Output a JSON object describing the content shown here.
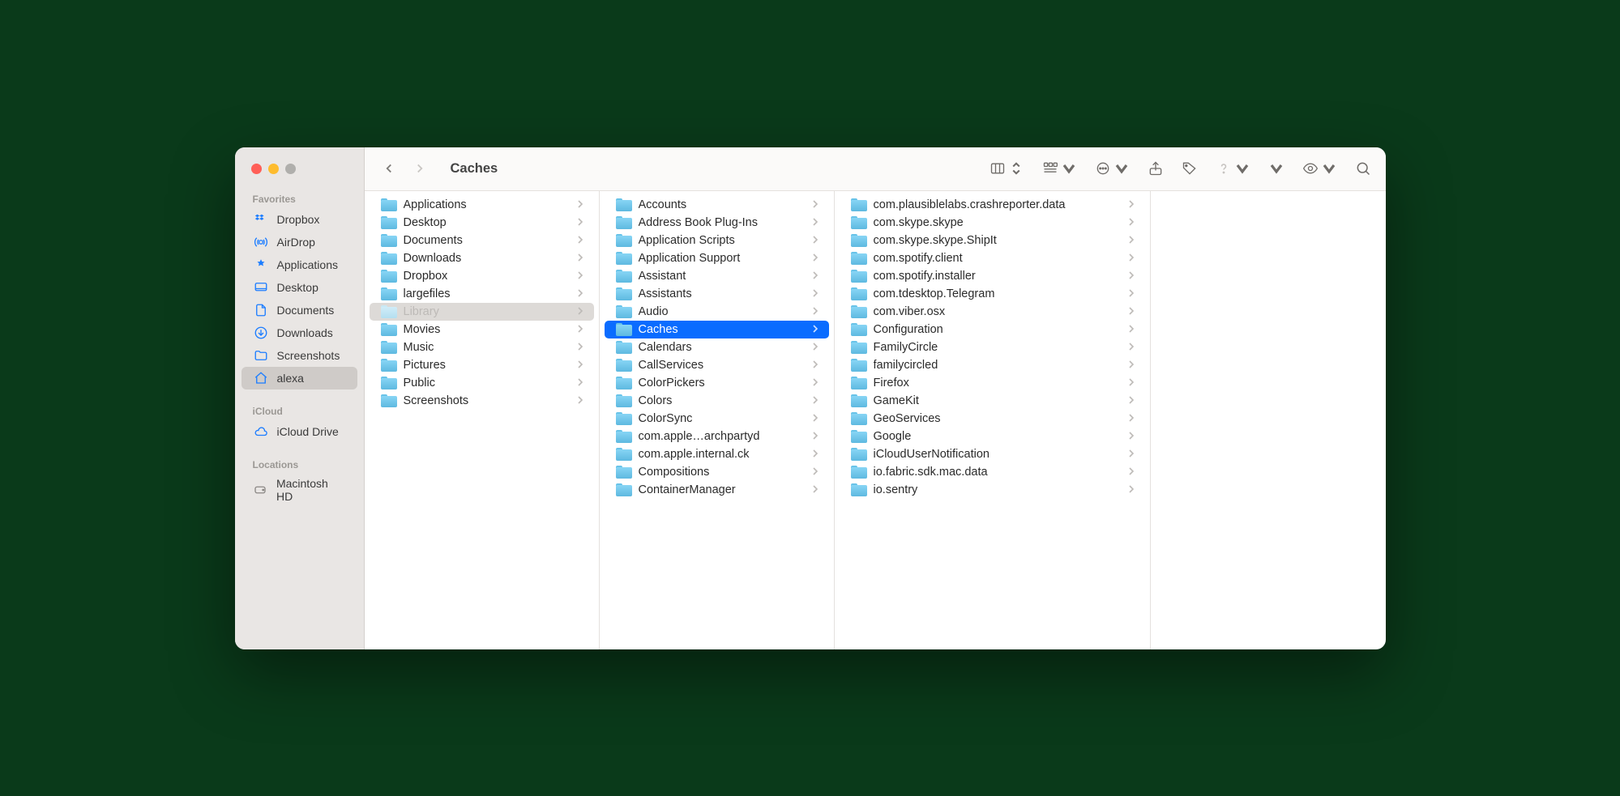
{
  "window_title": "Caches",
  "sidebar": {
    "sections": [
      {
        "label": "Favorites",
        "items": [
          {
            "icon": "dropbox",
            "label": "Dropbox"
          },
          {
            "icon": "airdrop",
            "label": "AirDrop"
          },
          {
            "icon": "apps",
            "label": "Applications"
          },
          {
            "icon": "desktop",
            "label": "Desktop"
          },
          {
            "icon": "documents",
            "label": "Documents"
          },
          {
            "icon": "downloads",
            "label": "Downloads"
          },
          {
            "icon": "folder",
            "label": "Screenshots"
          },
          {
            "icon": "home",
            "label": "alexa",
            "selected": true
          }
        ]
      },
      {
        "label": "iCloud",
        "items": [
          {
            "icon": "cloud",
            "label": "iCloud Drive"
          }
        ]
      },
      {
        "label": "Locations",
        "items": [
          {
            "icon": "disk",
            "label": "Macintosh HD",
            "gray": true
          }
        ]
      }
    ]
  },
  "columns": [
    {
      "items": [
        {
          "name": "Applications",
          "chev": true
        },
        {
          "name": "Desktop",
          "chev": true
        },
        {
          "name": "Documents",
          "chev": true
        },
        {
          "name": "Downloads",
          "chev": true
        },
        {
          "name": "Dropbox",
          "chev": true
        },
        {
          "name": "largefiles",
          "chev": true
        },
        {
          "name": "Library",
          "chev": true,
          "dimmed": true,
          "path_selected": true
        },
        {
          "name": "Movies",
          "chev": true
        },
        {
          "name": "Music",
          "chev": true
        },
        {
          "name": "Pictures",
          "chev": true
        },
        {
          "name": "Public",
          "chev": true
        },
        {
          "name": "Screenshots",
          "chev": true
        }
      ]
    },
    {
      "items": [
        {
          "name": "Accounts",
          "chev": true
        },
        {
          "name": "Address Book Plug-Ins",
          "chev": true
        },
        {
          "name": "Application Scripts",
          "chev": true
        },
        {
          "name": "Application Support",
          "chev": true
        },
        {
          "name": "Assistant",
          "chev": true
        },
        {
          "name": "Assistants",
          "chev": true
        },
        {
          "name": "Audio",
          "chev": true
        },
        {
          "name": "Caches",
          "chev": true,
          "selected": true
        },
        {
          "name": "Calendars",
          "chev": true
        },
        {
          "name": "CallServices",
          "chev": true
        },
        {
          "name": "ColorPickers",
          "chev": true
        },
        {
          "name": "Colors",
          "chev": true
        },
        {
          "name": "ColorSync",
          "chev": true
        },
        {
          "name": "com.apple…archpartyd",
          "chev": true
        },
        {
          "name": "com.apple.internal.ck",
          "chev": true
        },
        {
          "name": "Compositions",
          "chev": true
        },
        {
          "name": "ContainerManager",
          "chev": true
        }
      ]
    },
    {
      "wide": true,
      "items": [
        {
          "name": "com.plausiblelabs.crashreporter.data",
          "chev": true
        },
        {
          "name": "com.skype.skype",
          "chev": true
        },
        {
          "name": "com.skype.skype.ShipIt",
          "chev": true
        },
        {
          "name": "com.spotify.client",
          "chev": true
        },
        {
          "name": "com.spotify.installer",
          "chev": true
        },
        {
          "name": "com.tdesktop.Telegram",
          "chev": true
        },
        {
          "name": "com.viber.osx",
          "chev": true
        },
        {
          "name": "Configuration",
          "chev": true
        },
        {
          "name": "FamilyCircle",
          "chev": true
        },
        {
          "name": "familycircled",
          "chev": true
        },
        {
          "name": "Firefox",
          "chev": true
        },
        {
          "name": "GameKit",
          "chev": true
        },
        {
          "name": "GeoServices",
          "chev": true
        },
        {
          "name": "Google",
          "chev": true
        },
        {
          "name": "iCloudUserNotification",
          "chev": true
        },
        {
          "name": "io.fabric.sdk.mac.data",
          "chev": true
        },
        {
          "name": "io.sentry",
          "chev": true
        }
      ]
    },
    {
      "items": []
    }
  ]
}
